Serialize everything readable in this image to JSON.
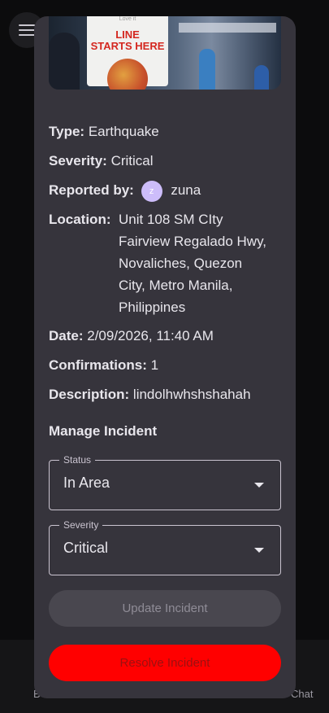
{
  "background": {
    "nav_left_label": "B",
    "nav_right_label": "Chat"
  },
  "photo": {
    "sign_small_text": "Love it",
    "sign_line1": "LINE",
    "sign_line2": "STARTS HERE"
  },
  "incident": {
    "type_label": "Type:",
    "type_value": "Earthquake",
    "severity_label": "Severity:",
    "severity_value": "Critical",
    "reported_label": "Reported by:",
    "reporter_initial": "z",
    "reporter_name": "zuna",
    "location_label": "Location:",
    "location_lines": [
      "Unit 108 SM CIty",
      "Fairview Regalado Hwy,",
      "Novaliches, Quezon",
      "City, Metro Manila,",
      "Philippines"
    ],
    "date_label": "Date:",
    "date_value": "2/09/2026, 11:40 AM",
    "confirmations_label": "Confirmations:",
    "confirmations_value": "1",
    "description_label": "Description:",
    "description_value": "lindolhwhshshahah"
  },
  "manage": {
    "title": "Manage Incident",
    "status_label": "Status",
    "status_value": "In Area",
    "severity_label": "Severity",
    "severity_value": "Critical",
    "update_button": "Update Incident",
    "resolve_button": "Resolve Incident"
  },
  "colors": {
    "modal_bg": "#36343c",
    "resolve_bg": "#ff0000",
    "avatar_bg": "#cdbdfa"
  }
}
